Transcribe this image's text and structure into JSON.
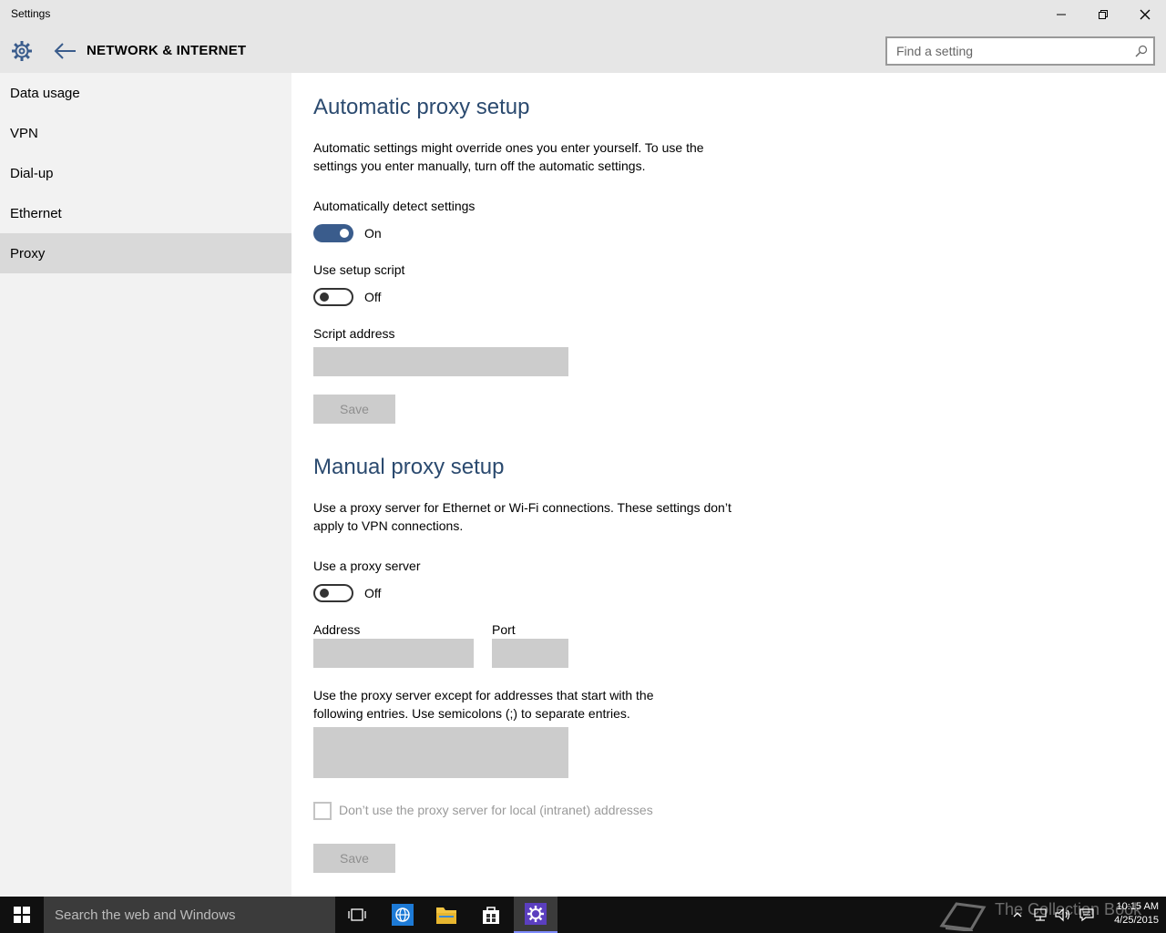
{
  "window": {
    "title": "Settings"
  },
  "header": {
    "section_title": "NETWORK & INTERNET",
    "search_placeholder": "Find a setting"
  },
  "sidebar": {
    "items": [
      {
        "label": "Data usage",
        "active": false
      },
      {
        "label": "VPN",
        "active": false
      },
      {
        "label": "Dial-up",
        "active": false
      },
      {
        "label": "Ethernet",
        "active": false
      },
      {
        "label": "Proxy",
        "active": true
      }
    ]
  },
  "automatic": {
    "heading": "Automatic proxy setup",
    "description": "Automatic settings might override ones you enter yourself. To use the settings you enter manually, turn off the automatic settings.",
    "detect_label": "Automatically detect settings",
    "detect_state": "On",
    "script_label": "Use setup script",
    "script_state": "Off",
    "script_address_label": "Script address",
    "script_address_value": "",
    "save_label": "Save"
  },
  "manual": {
    "heading": "Manual proxy setup",
    "description": "Use a proxy server for Ethernet or Wi-Fi connections. These settings don’t apply to VPN connections.",
    "use_proxy_label": "Use a proxy server",
    "use_proxy_state": "Off",
    "address_label": "Address",
    "address_value": "",
    "port_label": "Port",
    "port_value": "",
    "exceptions_description": "Use the proxy server except for addresses that start with the following entries. Use semicolons (;) to separate entries.",
    "exceptions_value": "",
    "local_checkbox_label": "Don’t use the proxy server for local (intranet) addresses",
    "local_checkbox_checked": false,
    "save_label": "Save"
  },
  "taskbar": {
    "search_placeholder": "Search the web and Windows",
    "watermark": "The Collection Book",
    "time": "10:15 AM",
    "date": "4/25/2015"
  },
  "colors": {
    "accent": "#3a5c8c",
    "heading": "#2b4a6f",
    "sidebar_bg": "#f2f2f2",
    "header_bg": "#e6e6e6",
    "taskbar_bg": "#101010"
  }
}
